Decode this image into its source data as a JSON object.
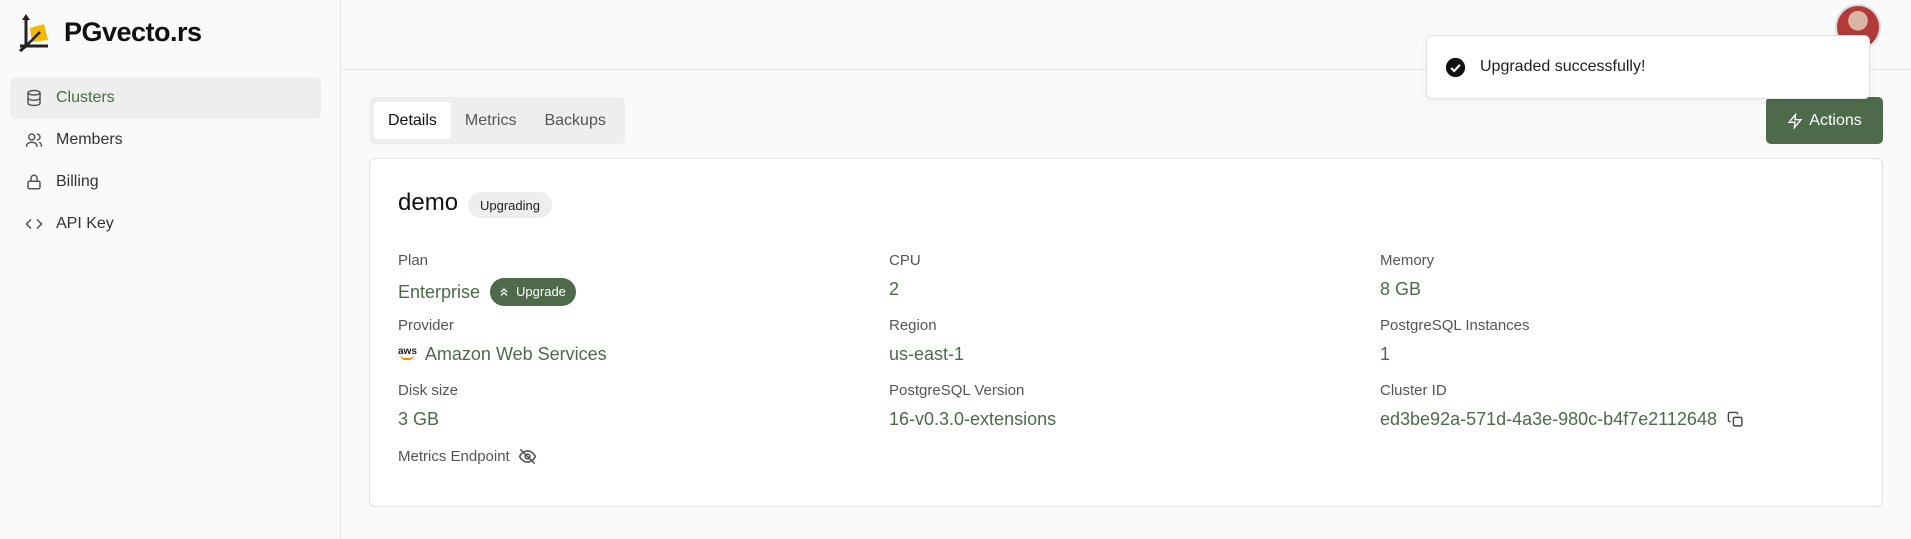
{
  "app": {
    "logo_text": "PGvecto.rs"
  },
  "sidebar": {
    "items": [
      {
        "label": "Clusters",
        "icon": "database-icon",
        "active": true
      },
      {
        "label": "Members",
        "icon": "users-icon",
        "active": false
      },
      {
        "label": "Billing",
        "icon": "lock-icon",
        "active": false
      },
      {
        "label": "API Key",
        "icon": "code-icon",
        "active": false
      }
    ]
  },
  "toast": {
    "message": "Upgraded successfully!",
    "icon": "check-circle-icon"
  },
  "tabs": [
    {
      "label": "Details",
      "active": true
    },
    {
      "label": "Metrics",
      "active": false
    },
    {
      "label": "Backups",
      "active": false
    }
  ],
  "actions_button": {
    "label": "Actions",
    "icon": "zap-icon"
  },
  "cluster": {
    "name": "demo",
    "status": "Upgrading",
    "plan_label": "Plan",
    "plan_value": "Enterprise",
    "upgrade_label": "Upgrade",
    "cpu_label": "CPU",
    "cpu_value": "2",
    "memory_label": "Memory",
    "memory_value": "8 GB",
    "provider_label": "Provider",
    "provider_logo_text": "aws",
    "provider_value": "Amazon Web Services",
    "region_label": "Region",
    "region_value": "us-east-1",
    "instances_label": "PostgreSQL Instances",
    "instances_value": "1",
    "disk_label": "Disk size",
    "disk_value": "3 GB",
    "pg_version_label": "PostgreSQL Version",
    "pg_version_value": "16-v0.3.0-extensions",
    "cluster_id_label": "Cluster ID",
    "cluster_id_value": "ed3be92a-571d-4a3e-980c-b4f7e2112648",
    "metrics_endpoint_label": "Metrics Endpoint"
  },
  "colors": {
    "accent": "#4d6a4a",
    "border": "#e3e3e3",
    "background": "#fafafa"
  }
}
